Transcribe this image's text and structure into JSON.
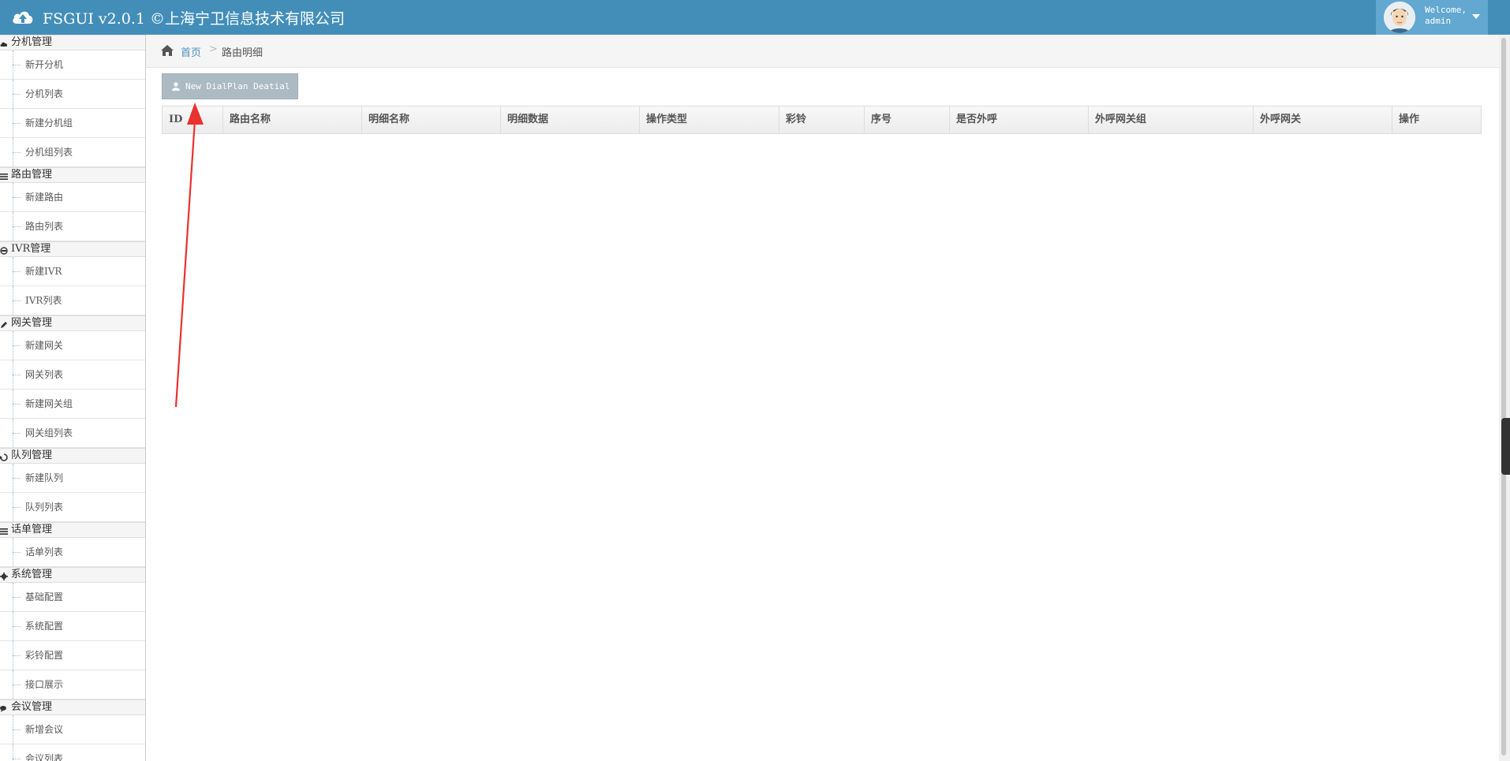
{
  "header": {
    "title": "FSGUI v2.0.1 ©上海宁卫信息技术有限公司",
    "welcome": "Welcome,",
    "username": "admin"
  },
  "sidebar": {
    "groups": [
      {
        "label": "分机管理",
        "icon": "cloud-icon",
        "items": [
          "新开分机",
          "分机列表",
          "新建分机组",
          "分机组列表"
        ]
      },
      {
        "label": "路由管理",
        "icon": "list-icon",
        "items": [
          "新建路由",
          "路由列表"
        ]
      },
      {
        "label": "IVR管理",
        "icon": "headset-icon",
        "items": [
          "新建IVR",
          "IVR列表"
        ]
      },
      {
        "label": "网关管理",
        "icon": "pencil-icon",
        "items": [
          "新建网关",
          "网关列表",
          "新建网关组",
          "网关组列表"
        ]
      },
      {
        "label": "队列管理",
        "icon": "recycle-icon",
        "items": [
          "新建队列",
          "队列列表"
        ]
      },
      {
        "label": "话单管理",
        "icon": "list-icon",
        "items": [
          "话单列表"
        ]
      },
      {
        "label": "系统管理",
        "icon": "gear-icon",
        "items": [
          "基础配置",
          "系统配置",
          "彩铃配置",
          "接口展示"
        ]
      },
      {
        "label": "会议管理",
        "icon": "comments-icon",
        "items": [
          "新增会议",
          "会议列表"
        ]
      }
    ]
  },
  "breadcrumb": {
    "home": "首页",
    "separator": ">",
    "current": "路由明细"
  },
  "toolbar": {
    "new_label": "New DialPlan Deatial"
  },
  "table": {
    "columns": [
      "ID",
      "路由名称",
      "明细名称",
      "明细数据",
      "操作类型",
      "彩铃",
      "序号",
      "是否外呼",
      "外呼网关组",
      "外呼网关",
      "操作"
    ]
  },
  "colors": {
    "header_bg": "#438eb9",
    "user_box_bg": "#62a8d1",
    "button_bg": "#abbac3",
    "link": "#4c8fbd",
    "annotation_arrow": "#e8322f"
  }
}
